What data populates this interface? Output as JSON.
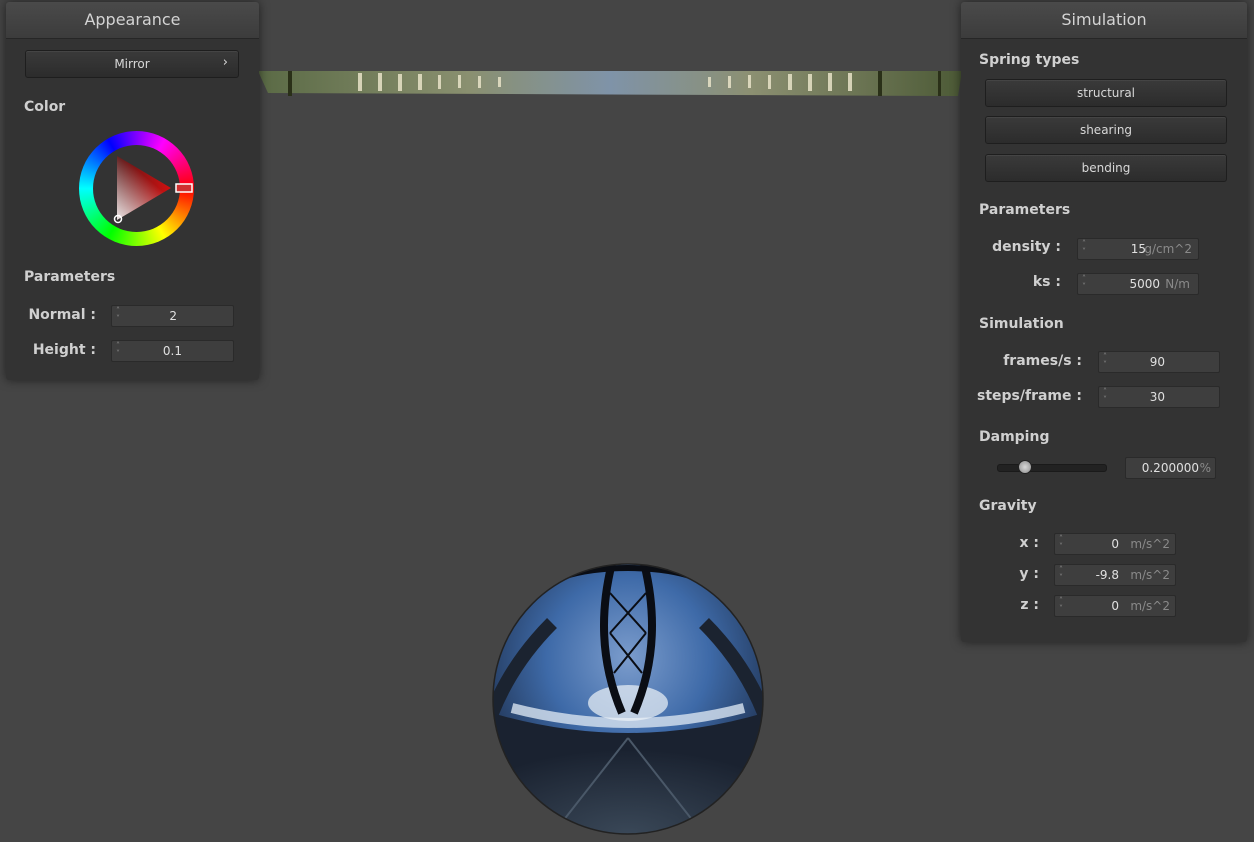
{
  "appearance": {
    "title": "Appearance",
    "shader_button": "Mirror",
    "shader_arrow": "›",
    "color_label": "Color",
    "parameters_label": "Parameters",
    "normal_label": "Normal :",
    "normal_value": "2",
    "height_label": "Height :",
    "height_value": "0.1"
  },
  "simulation": {
    "title": "Simulation",
    "spring_types_label": "Spring types",
    "springs": [
      "structural",
      "shearing",
      "bending"
    ],
    "parameters_label": "Parameters",
    "density_label": "density :",
    "density_value": "15",
    "density_unit": "g/cm^2",
    "ks_label": "ks :",
    "ks_value": "5000",
    "ks_unit": "N/m",
    "simulation_label": "Simulation",
    "fps_label": "frames/s :",
    "fps_value": "90",
    "steps_label": "steps/frame :",
    "steps_value": "30",
    "damping_label": "Damping",
    "damping_value": "0.200000",
    "damping_unit": "%",
    "damping_fraction": 0.2,
    "gravity_label": "Gravity",
    "gx_label": "x :",
    "gx_value": "0",
    "gy_label": "y :",
    "gy_value": "-9.8",
    "gz_label": "z :",
    "gz_value": "0",
    "gravity_unit": "m/s^2"
  },
  "colors": {
    "background": "#454545",
    "panel": "#333333",
    "selected_color": "#c8282a"
  }
}
